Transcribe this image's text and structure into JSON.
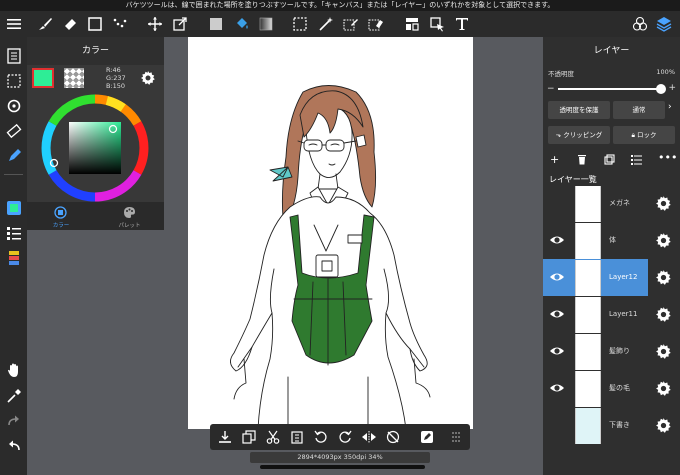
{
  "tip_text": "バケツツールは、線で囲まれた場所を塗りつぶすツールです。「キャンバス」または「レイヤー」のいずれかを対象として選択できます。",
  "color_panel": {
    "title": "カラー",
    "r_label": "R:46",
    "g_label": "G:237",
    "b_label": "B:150",
    "fg_color": "#2eed96",
    "tabs": [
      {
        "label": "カラー"
      },
      {
        "label": "パレット"
      }
    ]
  },
  "layer_panel": {
    "title": "レイヤー",
    "opacity_label": "不透明度",
    "opacity_value": "100%",
    "protect_label": "透明度を保護",
    "blend_label": "通常",
    "clipping_label": "クリッピング",
    "lock_label": "ロック",
    "list_header": "レイヤー一覧",
    "layers": [
      {
        "name": "メガネ",
        "visible": false,
        "selected": false
      },
      {
        "name": "体",
        "visible": true,
        "selected": false
      },
      {
        "name": "Layer12",
        "visible": true,
        "selected": true
      },
      {
        "name": "Layer11",
        "visible": true,
        "selected": false
      },
      {
        "name": "髪飾り",
        "visible": true,
        "selected": false
      },
      {
        "name": "髪の毛",
        "visible": true,
        "selected": false
      },
      {
        "name": "下書き",
        "visible": false,
        "selected": false
      }
    ]
  },
  "status_text": "2894*4093px 350dpi 34%",
  "colors": {
    "accent_selected": "#4a90d9",
    "corset_green": "#2f7a2f",
    "hair_brown": "#b0765a",
    "ribbon_teal": "#5fc8c8"
  }
}
